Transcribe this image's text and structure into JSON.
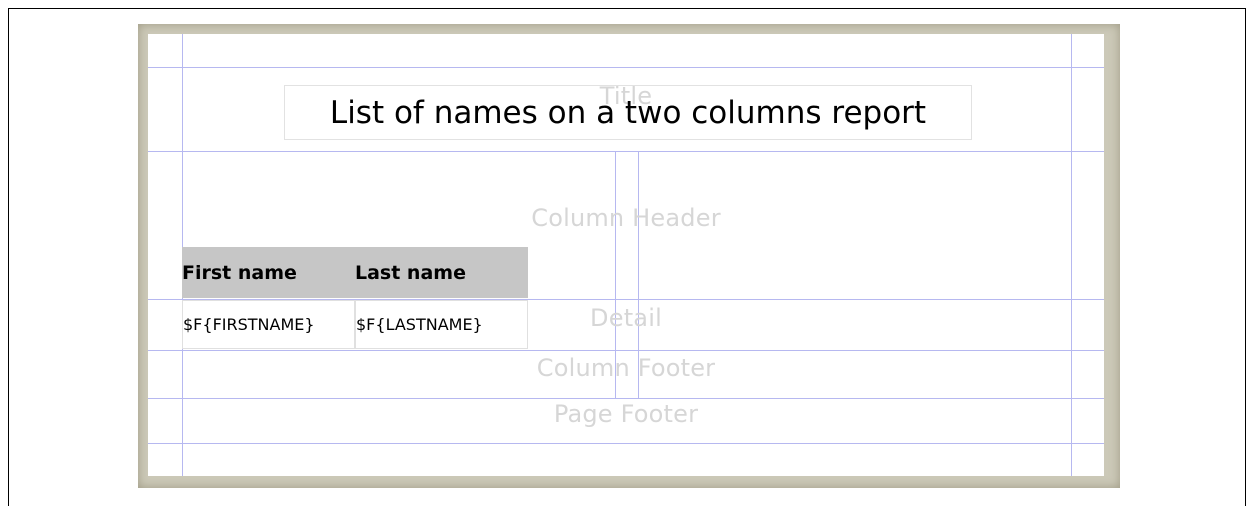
{
  "report": {
    "title": "List of names on a two columns report",
    "bands": {
      "title": "Title",
      "column_header": "Column Header",
      "detail": "Detail",
      "column_footer": "Column Footer",
      "page_footer": "Page Footer"
    },
    "column_headers": [
      "First name",
      "Last name"
    ],
    "detail_fields": [
      "$F{FIRSTNAME}",
      "$F{LASTNAME}"
    ]
  },
  "colors": {
    "guide_lines": "#b6b8f0",
    "band_label": "#d6d6d6",
    "header_background": "#c6c6c6",
    "page_shadow": "#ccc9b8"
  }
}
